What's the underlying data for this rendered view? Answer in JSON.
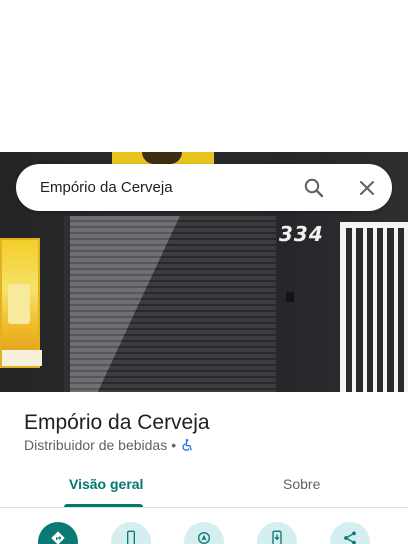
{
  "search": {
    "query": "Empório da Cerveja"
  },
  "photo": {
    "street_number": "334"
  },
  "place": {
    "name": "Empório da Cerveja",
    "category": "Distribuidor de bebidas",
    "separator": "•"
  },
  "tabs": [
    {
      "label": "Visão geral",
      "selected": true
    },
    {
      "label": "Sobre",
      "selected": false
    }
  ],
  "actions": [
    {
      "icon": "directions-icon"
    },
    {
      "icon": "phone-icon"
    },
    {
      "icon": "start-navigation-icon"
    },
    {
      "icon": "save-to-phone-icon"
    },
    {
      "icon": "share-icon"
    }
  ],
  "colors": {
    "accent": "#01796f",
    "primary_button": "#0b7a75",
    "secondary_button": "#d5eef0",
    "accessibility_icon": "#1a73e8"
  }
}
